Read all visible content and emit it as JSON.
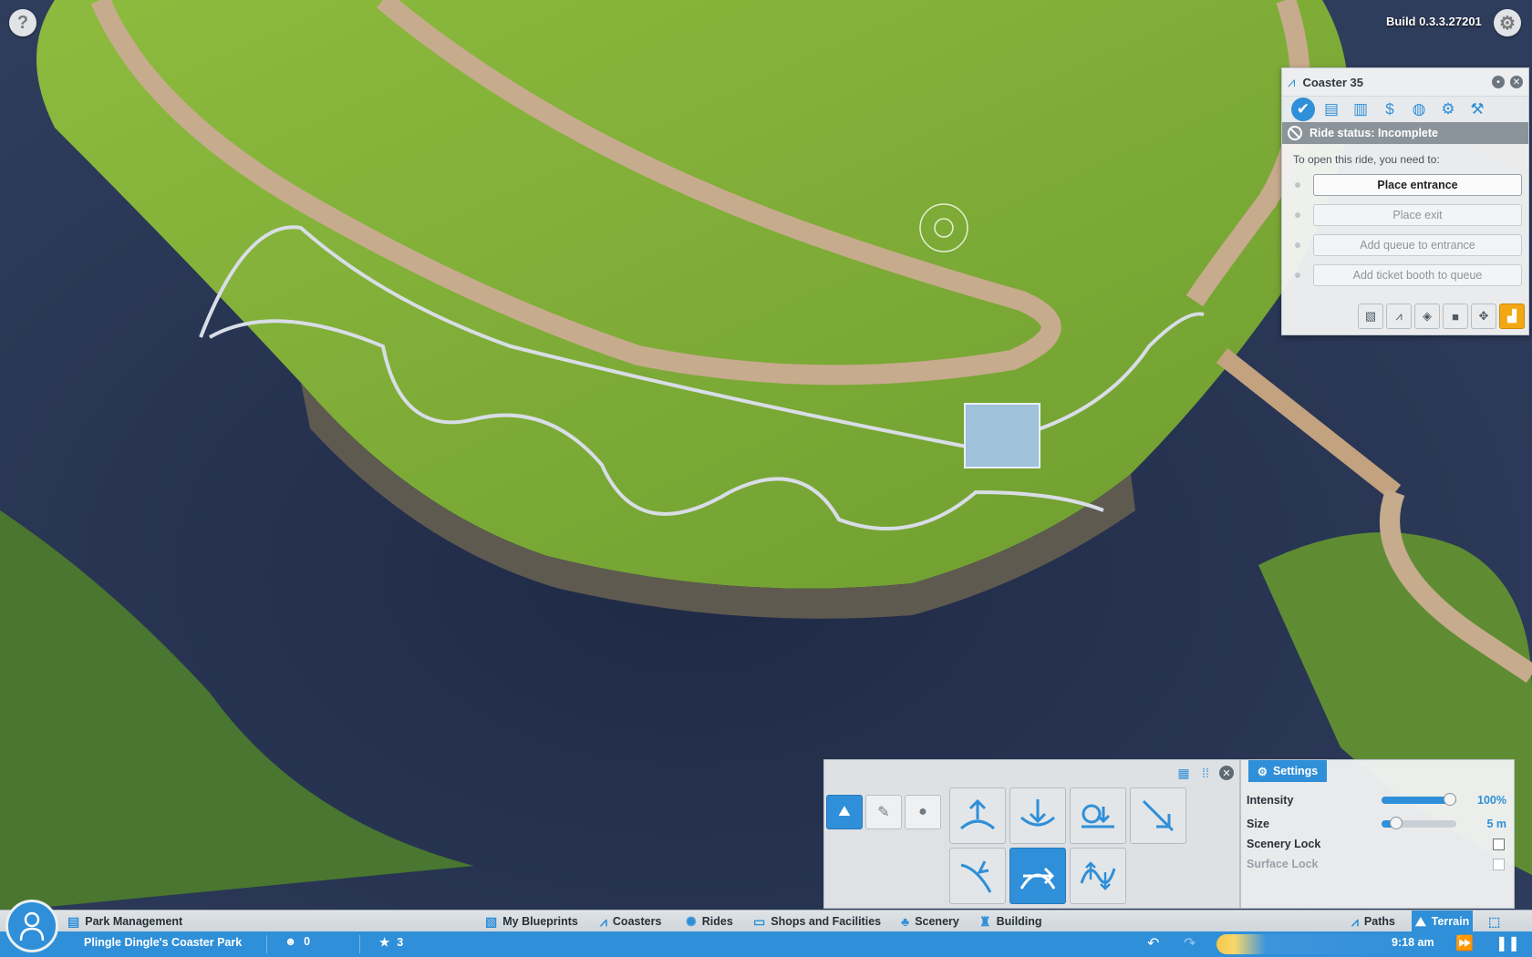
{
  "build": "Build 0.3.3.27201",
  "icons": {
    "help": "help-icon",
    "settings": "gear-icon"
  },
  "ride_window": {
    "title": "Coaster 35",
    "tabs": [
      "status-icon",
      "clipboard-icon",
      "stats-icon",
      "money-icon",
      "palette-icon",
      "gear-icon",
      "wrench-icon"
    ],
    "status": "Ride status: Incomplete",
    "requirements_header": "To open this ride, you need to:",
    "requirements": [
      "Place entrance",
      "Place exit",
      "Add queue to entrance",
      "Add ticket booth to queue"
    ],
    "tools": [
      "blueprint-icon",
      "coaster-icon",
      "track-piece-icon",
      "camera-icon",
      "move-icon",
      "bulldozer-icon"
    ]
  },
  "terrain_panel": {
    "modes": [
      "terrain-sculpt-icon",
      "paint-brush-icon",
      "water-drop-icon"
    ],
    "tools": [
      "raise-icon",
      "lower-icon",
      "level-icon",
      "smooth-icon",
      "ramp-icon",
      "flatten-icon",
      "noise-icon"
    ]
  },
  "settings_panel": {
    "tab": "Settings",
    "intensity_label": "Intensity",
    "intensity_value": "100%",
    "intensity_level": 1.0,
    "size_label": "Size",
    "size_value": "5 m",
    "size_level": 0.2,
    "scenery_lock_label": "Scenery Lock",
    "surface_lock_label": "Surface Lock"
  },
  "toolbar": {
    "park_management": "Park Management",
    "my_blueprints": "My Blueprints",
    "coasters": "Coasters",
    "rides": "Rides",
    "shops": "Shops and Facilities",
    "scenery": "Scenery",
    "building": "Building",
    "paths": "Paths",
    "terrain": "Terrain"
  },
  "status_bar": {
    "park_name": "Plingle Dingle's Coaster Park",
    "guests": "0",
    "rating": "3",
    "time": "9:18 am"
  },
  "colors": {
    "accent": "#2f8fd8",
    "water": "#2a3552",
    "grass": "#7fae3a",
    "highlight": "#f2a814"
  }
}
